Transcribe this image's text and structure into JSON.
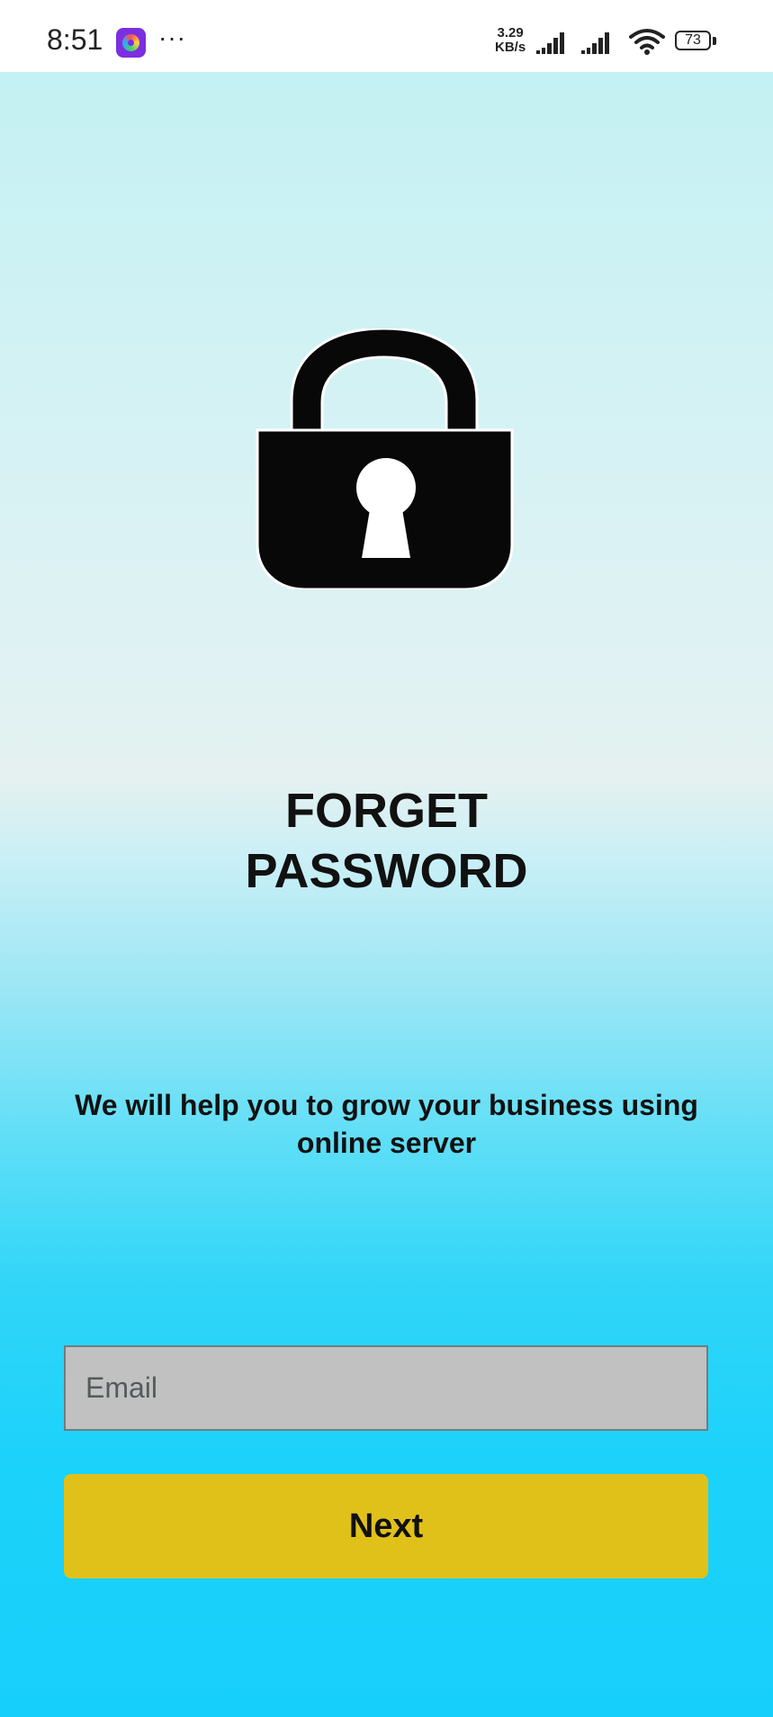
{
  "status_bar": {
    "time": "8:51",
    "more_label": "···",
    "net_speed_value": "3.29",
    "net_speed_unit": "KB/s",
    "battery_level": "73"
  },
  "screen": {
    "title_line1": "FORGET",
    "title_line2": "PASSWORD",
    "subtitle": "We will help you to grow your business using online server",
    "email_placeholder": "Email",
    "email_value": "",
    "next_label": "Next"
  },
  "colors": {
    "button": "#e0c11a",
    "input_background": "#c1c1c1",
    "gradient_top": "#c4f1f3",
    "gradient_bottom": "#17cffb"
  }
}
